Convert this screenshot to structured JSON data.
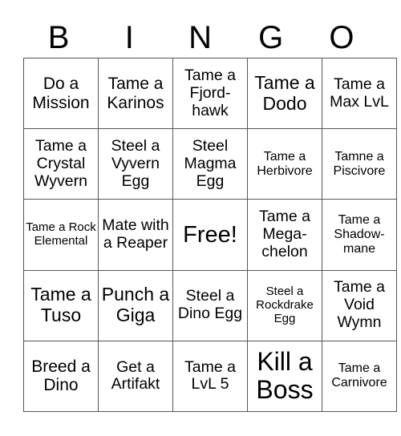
{
  "header": {
    "letters": [
      "B",
      "I",
      "N",
      "G",
      "O"
    ]
  },
  "cells": [
    [
      "Do a Mission",
      "Tame a Karinos",
      "Tame a Fjord-hawk",
      "Tame a Dodo",
      "Tame a Max LvL"
    ],
    [
      "Tame a Crystal Wyvern",
      "Steel a Vyvern Egg",
      "Steel Magma Egg",
      "Tame a Herbivore",
      "Tamne a Piscivore"
    ],
    [
      "Tame a Rock Elemental",
      "Mate with a Reaper",
      "Free!",
      "Tame a Mega-chelon",
      "Tame a Shadow-mane"
    ],
    [
      "Tame a Tuso",
      "Punch a Giga",
      "Steel a Dino Egg",
      "Steel a Rockdrake Egg",
      "Tame a Void Wymn"
    ],
    [
      "Breed a Dino",
      "Get a Artifakt",
      "Tame a LvL 5",
      "Kill a Boss",
      "Tame a Carnivore"
    ]
  ]
}
